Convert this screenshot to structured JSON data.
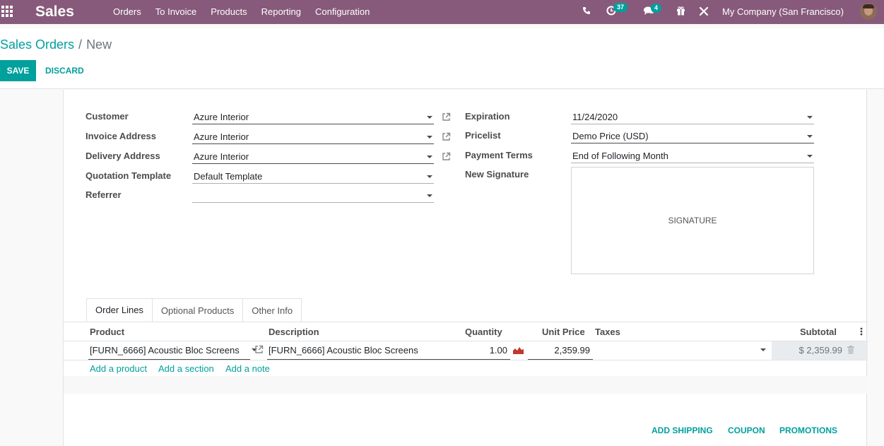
{
  "navbar": {
    "brand": "Sales",
    "menu": [
      "Orders",
      "To Invoice",
      "Products",
      "Reporting",
      "Configuration"
    ],
    "activities_count": "37",
    "messages_count": "4",
    "company": "My Company (San Francisco)"
  },
  "breadcrumb": {
    "parent": "Sales Orders",
    "separator": "/",
    "current": "New"
  },
  "buttons": {
    "save": "SAVE",
    "discard": "DISCARD"
  },
  "form": {
    "customer": {
      "label": "Customer",
      "value": "Azure Interior"
    },
    "invoice_address": {
      "label": "Invoice Address",
      "value": "Azure Interior"
    },
    "delivery_address": {
      "label": "Delivery Address",
      "value": "Azure Interior"
    },
    "quotation_template": {
      "label": "Quotation Template",
      "value": "Default Template"
    },
    "referrer": {
      "label": "Referrer",
      "value": ""
    },
    "expiration": {
      "label": "Expiration",
      "value": "11/24/2020"
    },
    "pricelist": {
      "label": "Pricelist",
      "value": "Demo Price (USD)"
    },
    "payment_terms": {
      "label": "Payment Terms",
      "value": "End of Following Month"
    },
    "signature": {
      "label": "New Signature",
      "placeholder": "SIGNATURE"
    }
  },
  "tabs": [
    "Order Lines",
    "Optional Products",
    "Other Info"
  ],
  "table": {
    "headers": {
      "product": "Product",
      "description": "Description",
      "quantity": "Quantity",
      "unit_price": "Unit Price",
      "taxes": "Taxes",
      "subtotal": "Subtotal"
    },
    "row": {
      "product": "[FURN_6666] Acoustic Bloc Screens",
      "description": "[FURN_6666] Acoustic Bloc Screens",
      "quantity": "1.00",
      "unit_price": "2,359.99",
      "taxes": "",
      "subtotal": "$ 2,359.99"
    },
    "add_links": [
      "Add a product",
      "Add a section",
      "Add a note"
    ]
  },
  "actions": [
    "ADD SHIPPING",
    "COUPON",
    "PROMOTIONS"
  ],
  "colors": {
    "navbar": "#875a7b",
    "accent": "#00a09d"
  }
}
